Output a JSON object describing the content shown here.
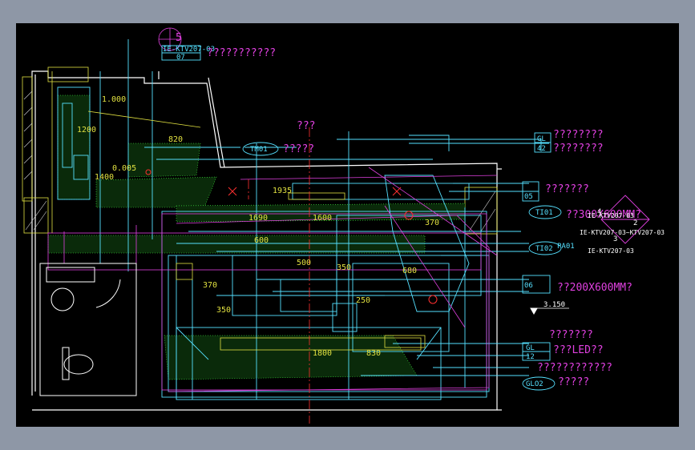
{
  "drawing": {
    "colors": {
      "window_bg": "#8e97a6",
      "sheet_bg": "#000000",
      "wall": "#ffffff",
      "cyan": "#55e0ff",
      "magenta": "#e040e0",
      "green": "#44ff44",
      "yellow": "#e0e040",
      "red": "#ff3030"
    },
    "top_tag": {
      "number": "5",
      "ref": "IE-KTV207-03",
      "sub": "07",
      "note": "???????????"
    },
    "right_notes": {
      "gl_a": "GL",
      "gl_a_num": "42",
      "note_a1": "????????",
      "note_a2": "????????",
      "n05_tag": "05",
      "note_b": "???????",
      "t101_tag": "TI01",
      "note_c": "??300X600MM?",
      "diamond_a": "4",
      "diamond_b": "2",
      "diamond_c": "3",
      "diamond_ref1": "IE-KTV207-03",
      "diamond_ref2": "IE-KTV207-03~KTV207-03",
      "diamond_ref3": "IE-KTV207-03",
      "t102_tag": "TI02",
      "pa01_tag": "PA01",
      "note_d": "??200X600MM?",
      "n06_tag": "06",
      "level": "3.150",
      "note_e": "???????",
      "gl_b": "GL",
      "gl_b_num": "12",
      "note_f": "???LED??",
      "note_g": "????????????",
      "glo2_tag": "GLO2",
      "note_h": "?????"
    },
    "left_notes": {
      "tm01_tag": "TM01",
      "note": "?????"
    },
    "center_note": "???",
    "dimensions": {
      "d1000": "1.000",
      "d820": "820",
      "d0005": "0.005",
      "d1400": "1400",
      "d1935": "1935",
      "d1690": "1690",
      "d1600": "1600",
      "d600": "600",
      "d500": "500",
      "d350a": "350",
      "d350b": "350",
      "d250": "250",
      "d1800": "1800",
      "d370": "370",
      "d680": "680",
      "d830": "830",
      "d5370": "370",
      "d1200": "1200"
    }
  }
}
